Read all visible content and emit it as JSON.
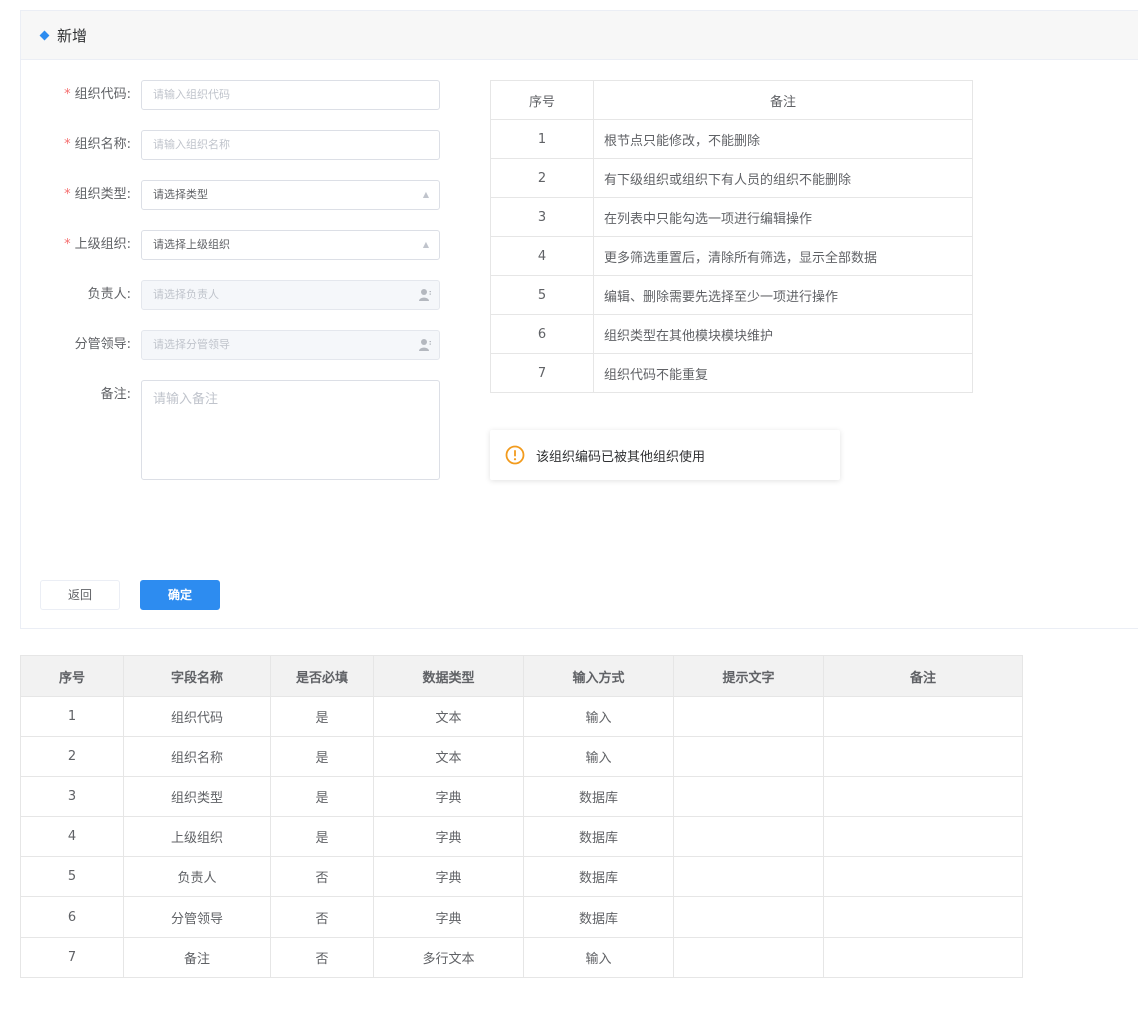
{
  "header": {
    "title": "新增"
  },
  "form": {
    "fields": [
      {
        "label": "组织代码:",
        "required": true,
        "placeholder": "请输入组织代码"
      },
      {
        "label": "组织名称:",
        "required": true,
        "placeholder": "请输入组织名称"
      },
      {
        "label": "组织类型:",
        "required": true,
        "value": "请选择类型"
      },
      {
        "label": "上级组织:",
        "required": true,
        "value": "请选择上级组织"
      },
      {
        "label": "负责人:",
        "required": false,
        "placeholder": "请选择负责人"
      },
      {
        "label": "分管领导:",
        "required": false,
        "placeholder": "请选择分管领导"
      },
      {
        "label": "备注:",
        "required": false,
        "placeholder": "请输入备注"
      }
    ],
    "required_mark": "*"
  },
  "notes_table": {
    "headers": [
      "序号",
      "备注"
    ],
    "rows": [
      [
        "1",
        "根节点只能修改，不能删除"
      ],
      [
        "2",
        "有下级组织或组织下有人员的组织不能删除"
      ],
      [
        "3",
        "在列表中只能勾选一项进行编辑操作"
      ],
      [
        "4",
        "更多筛选重置后，清除所有筛选，显示全部数据"
      ],
      [
        "5",
        "编辑、删除需要先选择至少一项进行操作"
      ],
      [
        "6",
        "组织类型在其他模块模块维护"
      ],
      [
        "7",
        "组织代码不能重复"
      ]
    ]
  },
  "alert": {
    "text": "该组织编码已被其他组织使用",
    "icon": "warning-icon",
    "color": "#f29b1d"
  },
  "buttons": {
    "back": "返回",
    "confirm": "确定"
  },
  "field_table": {
    "headers": [
      "序号",
      "字段名称",
      "是否必填",
      "数据类型",
      "输入方式",
      "提示文字",
      "备注"
    ],
    "rows": [
      [
        "1",
        "组织代码",
        "是",
        "文本",
        "输入",
        "",
        ""
      ],
      [
        "2",
        "组织名称",
        "是",
        "文本",
        "输入",
        "",
        ""
      ],
      [
        "3",
        "组织类型",
        "是",
        "字典",
        "数据库",
        "",
        ""
      ],
      [
        "4",
        "上级组织",
        "是",
        "字典",
        "数据库",
        "",
        ""
      ],
      [
        "5",
        "负责人",
        "否",
        "字典",
        "数据库",
        "",
        ""
      ],
      [
        "6",
        "分管领导",
        "否",
        "字典",
        "数据库",
        "",
        ""
      ],
      [
        "7",
        "备注",
        "否",
        "多行文本",
        "输入",
        "",
        ""
      ]
    ]
  },
  "colors": {
    "primary": "#2d8cf0",
    "required": "#f56c6c",
    "warning": "#f29b1d"
  }
}
